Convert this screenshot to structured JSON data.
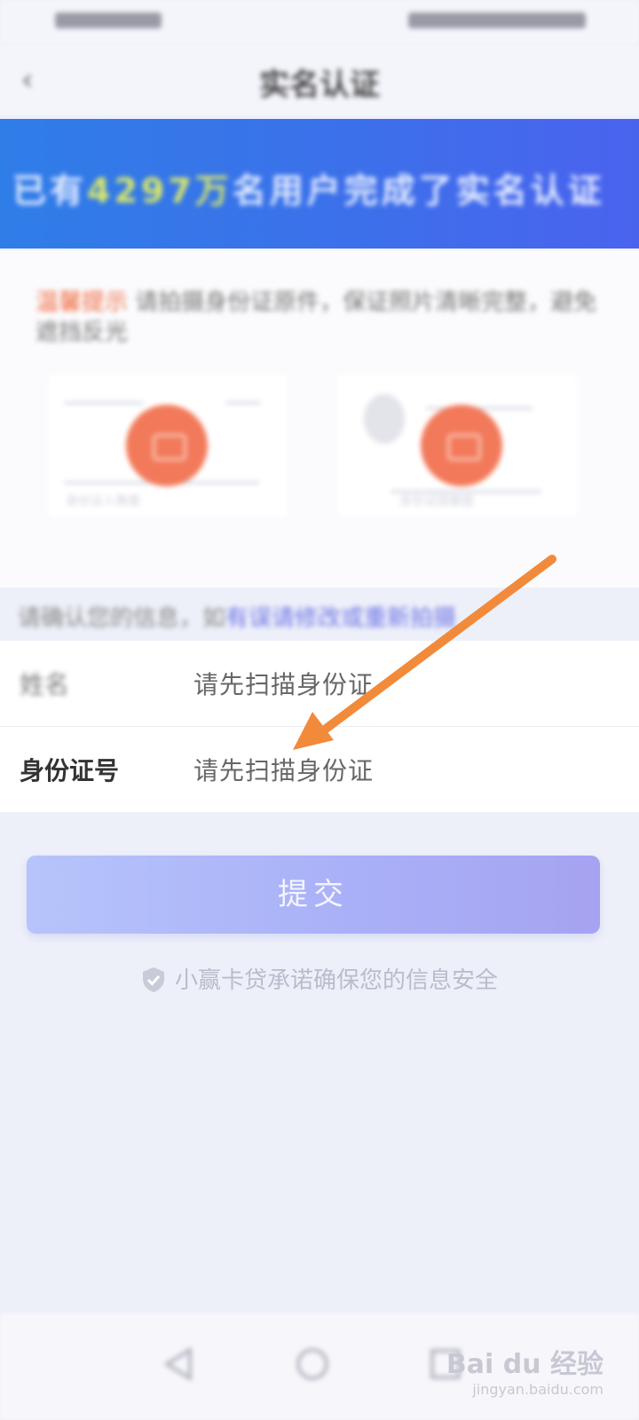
{
  "header": {
    "title": "实名认证"
  },
  "banner": {
    "prefix": "已有",
    "highlight": "4297万",
    "suffix": "名用户完成了实名认证"
  },
  "upload": {
    "tip_tag": "温馨提示",
    "tip_text": "请拍摄身份证原件，保证照片清晰完整，避免遮挡反光",
    "front_card": "身份证人像面",
    "back_card": "身份证国徽面"
  },
  "confirm": {
    "prefix": "请确认您的信息，如",
    "link": "有误请修改或重新拍摄"
  },
  "form": {
    "name_label": "姓名",
    "name_value": "请先扫描身份证",
    "id_label": "身份证号",
    "id_value": "请先扫描身份证"
  },
  "submit_label": "提交",
  "security_note": "小赢卡贷承诺确保您的信息安全",
  "watermark": {
    "logo": "Bai du 经验",
    "site": "jingyan.baidu.com"
  },
  "colors": {
    "banner": "#3c70ea",
    "accent": "#f27a5a",
    "button": "#a9aff7",
    "arrow": "#f28a3c"
  }
}
